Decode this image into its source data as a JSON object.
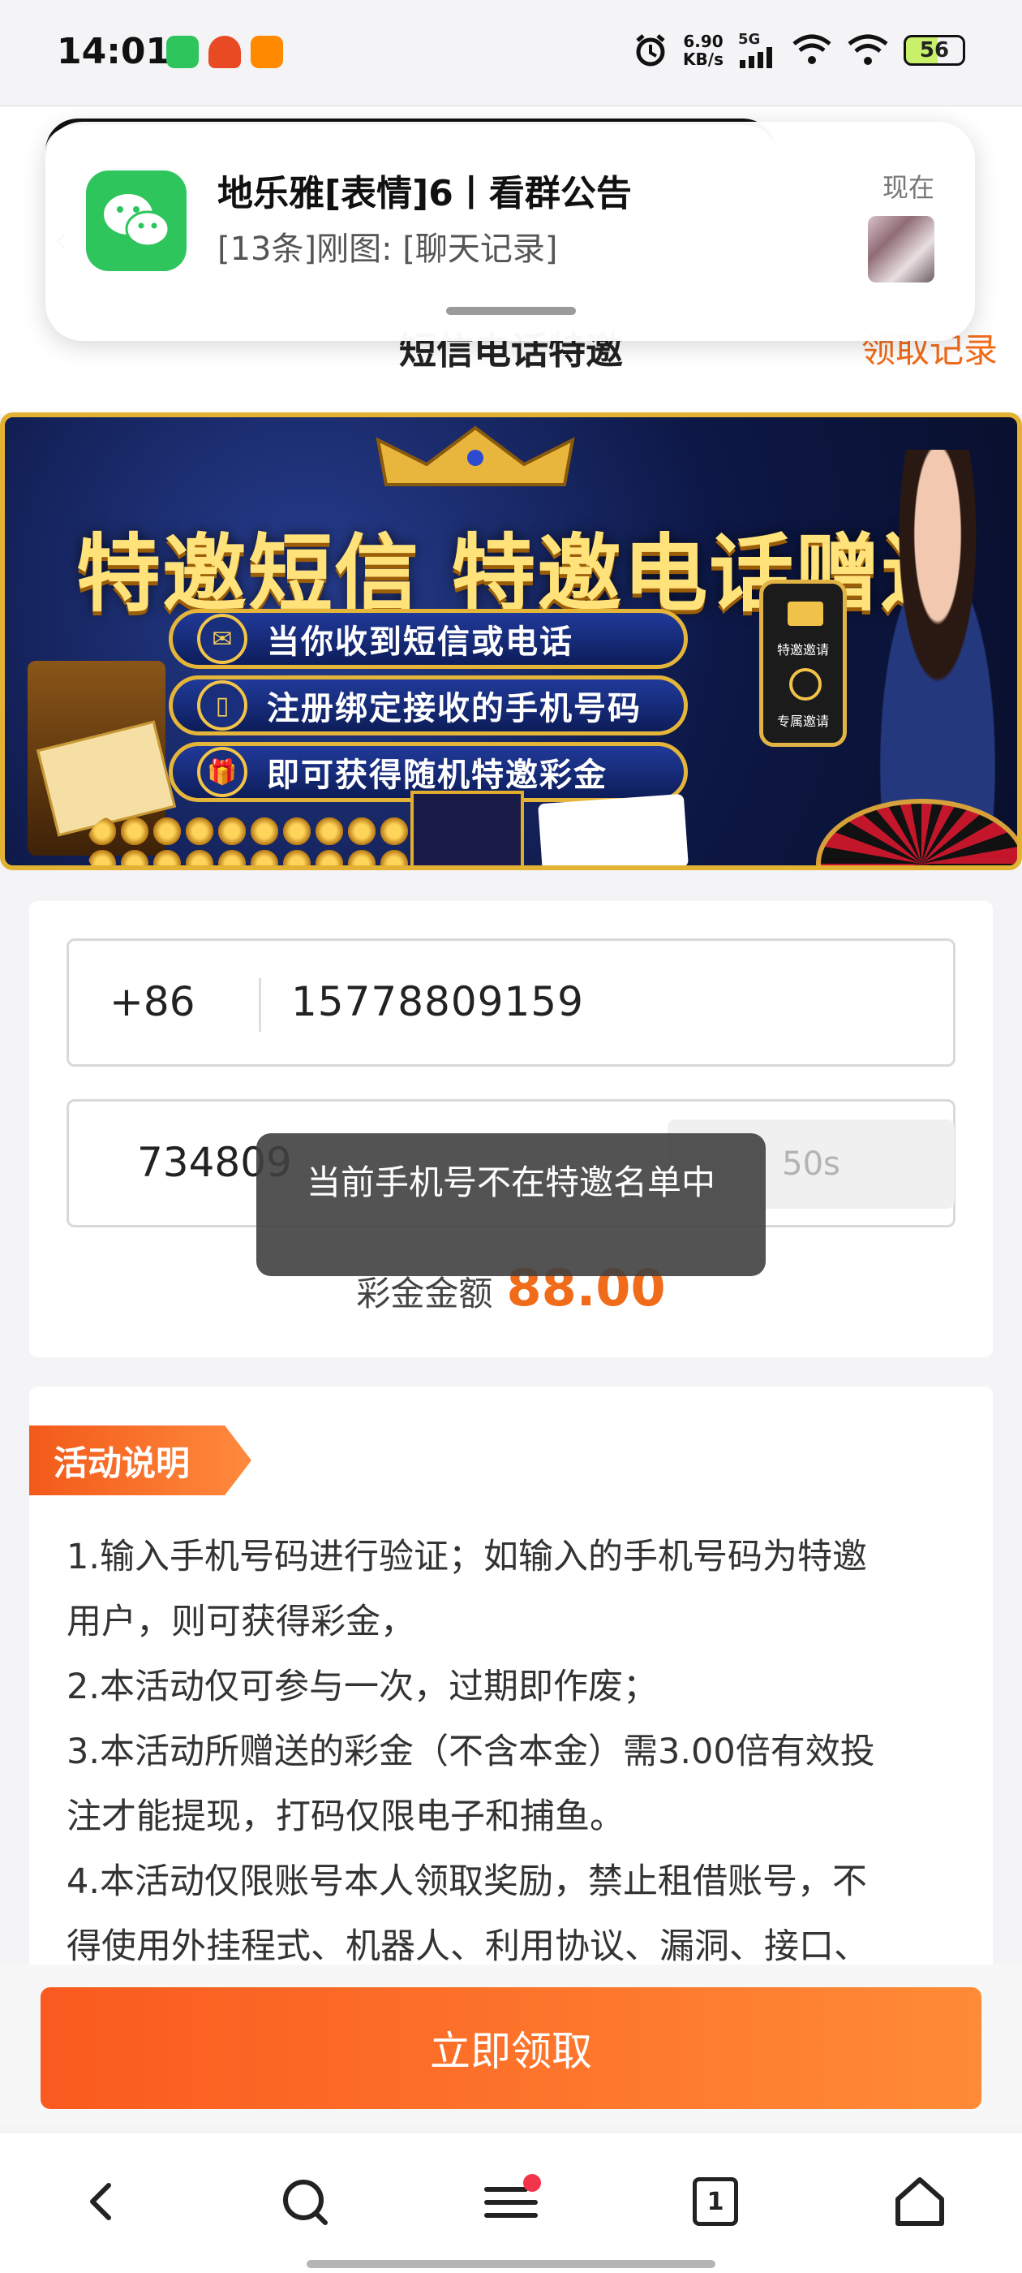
{
  "status_bar": {
    "time": "14:01",
    "net_speed_value": "6.90",
    "net_speed_unit": "KB/s",
    "network": "5G",
    "battery": "56"
  },
  "notification": {
    "title": "地乐雅[表情]6丨看群公告",
    "body": "[13条]刚图: [聊天记录]",
    "time": "现在",
    "app_icon": "wechat-icon"
  },
  "header": {
    "back_icon": "‹",
    "title": "短信电话特邀",
    "record_link": "领取记录"
  },
  "banner": {
    "title": "特邀短信 特邀电话赠送",
    "lines": [
      {
        "icon": "✉",
        "text": "当你收到短信或电话"
      },
      {
        "icon": "▯",
        "text": "注册绑定接收的手机号码"
      },
      {
        "icon": "🎁",
        "text": "即可获得随机特邀彩金"
      }
    ],
    "phone_labels": [
      "特邀邀请",
      "专属邀请"
    ]
  },
  "form": {
    "country_code": "+86",
    "phone_number": "15778809159",
    "verification_code": "734809",
    "countdown": "50s",
    "amount_label": "彩金金额",
    "amount_value": "88.00"
  },
  "toast": {
    "message": "当前手机号不在特邀名单中"
  },
  "activity": {
    "badge": "活动说明",
    "rules": [
      "1.输入手机号码进行验证；如输入的手机号码为特邀",
      "用户，则可获得彩金，",
      "2.本活动仅可参与一次，过期即作废；",
      "3.本活动所赠送的彩金（不含本金）需3.00倍有效投",
      "注才能提现，打码仅限电子和捕鱼。",
      "4.本活动仅限账号本人领取奖励，禁止租借账号，不",
      "得使用外挂程式、机器人、利用协议、漏洞、接口、"
    ]
  },
  "claim_button": "立即领取",
  "browser_bar": {
    "tab_count": "1",
    "icons": [
      "back-icon",
      "search-icon",
      "menu-icon",
      "tabs-icon",
      "home-icon"
    ]
  }
}
